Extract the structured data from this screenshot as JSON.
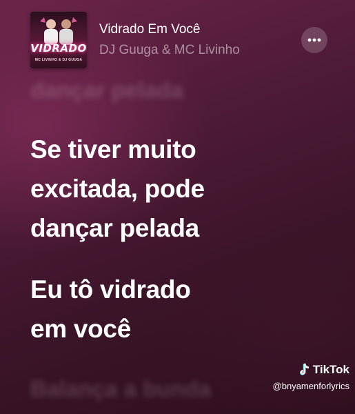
{
  "now_playing": {
    "album_art": {
      "title": "VIDRADO",
      "subtitle": "MC LIVINHO & DJ GUUGA"
    },
    "title": "Vidrado Em Você",
    "artist": "DJ Guuga & MC Livinho",
    "more_icon": "ellipsis-icon"
  },
  "lyrics": {
    "previous_line": "dançar pelada",
    "active": [
      {
        "lines": [
          "Se tiver muito",
          "excitada, pode",
          "dançar pelada"
        ]
      },
      {
        "lines": [
          "Eu tô vidrado",
          "em você"
        ]
      }
    ],
    "next_line": "Balança a bunda"
  },
  "watermark": {
    "brand": "TikTok",
    "handle": "@bnyamenforlyrics",
    "icon": "tiktok-note-icon"
  },
  "colors": {
    "background_top": "#6a2448",
    "background_bottom": "#2e0f1e",
    "text_primary": "#ffffff",
    "text_secondary": "rgba(255,255,255,0.5)"
  }
}
